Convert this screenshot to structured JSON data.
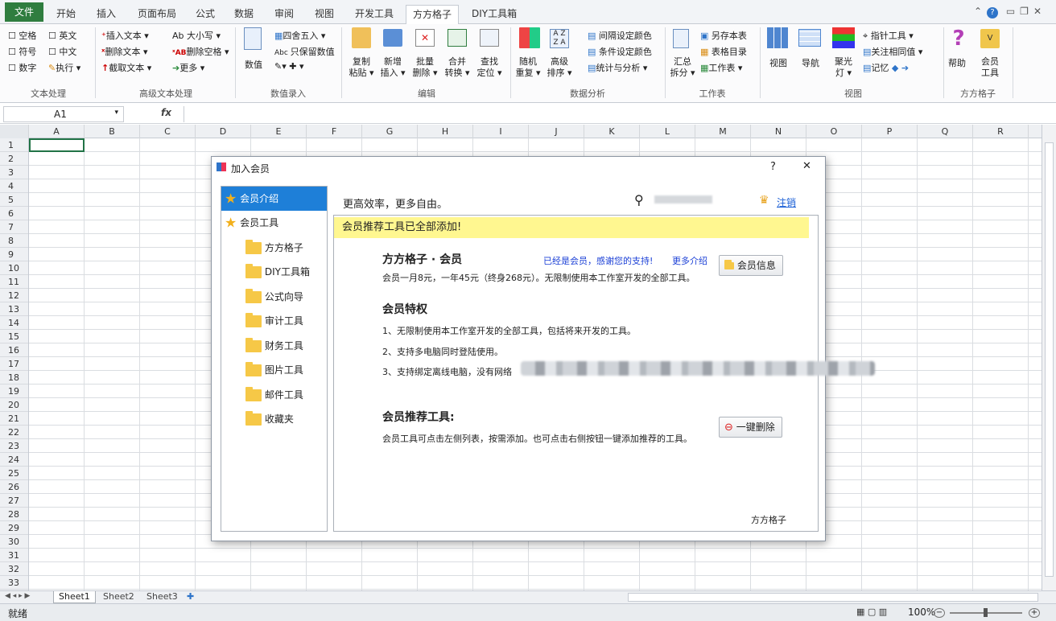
{
  "ribbon_tabs": [
    "文件",
    "开始",
    "插入",
    "页面布局",
    "公式",
    "数据",
    "审阅",
    "视图",
    "开发工具",
    "方方格子",
    "DIY工具箱"
  ],
  "active_tab": "方方格子",
  "ribbon": {
    "text_group": {
      "label": "文本处理",
      "items": [
        "空格",
        "英文",
        "符号",
        "中文",
        "数字",
        "执行 ▾"
      ]
    },
    "adv_text_group": {
      "label": "高级文本处理",
      "items": [
        "插入文本 ▾",
        "删除文本 ▾",
        "截取文本 ▾",
        "Ab 大小写 ▾",
        "删除空格 ▾",
        "更多 ▾"
      ]
    },
    "value_group": {
      "label": "数值录入",
      "items": [
        "四舍五入 ▾",
        "只保留数值",
        "数值"
      ]
    },
    "edit_group": {
      "label": "编辑",
      "items": [
        "复制粘贴 ▾",
        "新增插入 ▾",
        "批量删除 ▾",
        "合并转换 ▾",
        "查找定位 ▾"
      ]
    },
    "analysis_group": {
      "label": "数据分析",
      "items": [
        "随机重复 ▾",
        "高级排序 ▾",
        "间隔设定颜色",
        "条件设定颜色",
        "统计与分析 ▾"
      ]
    },
    "sheet_group": {
      "label": "工作表",
      "items": [
        "汇总拆分 ▾",
        "另存本表",
        "表格目录",
        "工作表 ▾"
      ]
    },
    "view_group": {
      "label": "视图",
      "items": [
        "视图",
        "导航",
        "聚光灯 ▾",
        "指针工具 ▾",
        "关注相同值 ▾",
        "记忆"
      ]
    },
    "ffgz_group": {
      "label": "方方格子",
      "items": [
        "帮助",
        "会员工具"
      ]
    }
  },
  "formula_bar": {
    "cell_ref": "A1",
    "fx": "fx"
  },
  "columns": [
    "A",
    "B",
    "C",
    "D",
    "E",
    "F",
    "G",
    "H",
    "I",
    "J",
    "K",
    "L",
    "M",
    "N",
    "O",
    "P",
    "Q",
    "R"
  ],
  "rows": [
    "1",
    "2",
    "3",
    "4",
    "5",
    "6",
    "7",
    "8",
    "9",
    "10",
    "11",
    "12",
    "13",
    "14",
    "15",
    "16",
    "17",
    "18",
    "19",
    "20",
    "21",
    "22",
    "23",
    "24",
    "25",
    "26",
    "27",
    "28",
    "29",
    "30",
    "31",
    "32",
    "33"
  ],
  "sheets": [
    "Sheet1",
    "Sheet2",
    "Sheet3"
  ],
  "status": {
    "ready": "就绪",
    "zoom": "100%"
  },
  "dialog": {
    "title": "加入会员",
    "help": "?",
    "close": "✕",
    "nav": [
      {
        "label": "会员介绍",
        "selected": true,
        "icon": "star-icon"
      },
      {
        "label": "会员工具",
        "icon": "star-icon"
      },
      {
        "label": "方方格子",
        "icon": "folder-icon"
      },
      {
        "label": "DIY工具箱",
        "icon": "folder-icon"
      },
      {
        "label": "公式向导",
        "icon": "folder-icon"
      },
      {
        "label": "审计工具",
        "icon": "folder-icon"
      },
      {
        "label": "财务工具",
        "icon": "folder-icon"
      },
      {
        "label": "图片工具",
        "icon": "folder-icon"
      },
      {
        "label": "邮件工具",
        "icon": "folder-icon"
      },
      {
        "label": "收藏夹",
        "icon": "folder-icon"
      }
    ],
    "slogan": "更高效率，更多自由。",
    "logout": "注销",
    "banner": "会员推荐工具已全部添加!",
    "member_title": "方方格子 · 会员",
    "thanks": "已经是会员，感谢您的支持!",
    "more": "更多介绍",
    "member_info_btn": "会员信息",
    "price": "会员一月8元，一年45元（终身268元）。无限制使用本工作室开发的全部工具。",
    "privilege_title": "会员特权",
    "privileges": [
      "1、无限制使用本工作室开发的全部工具，包括将来开发的工具。",
      "2、支持多电脑同时登陆使用。",
      "3、支持绑定离线电脑，没有网络"
    ],
    "recommend_title": "会员推荐工具:",
    "recommend_desc": "会员工具可点击左侧列表，按需添加。也可点击右侧按钮一键添加推荐的工具。",
    "delete_btn": "一键删除",
    "footer": "方方格子"
  }
}
